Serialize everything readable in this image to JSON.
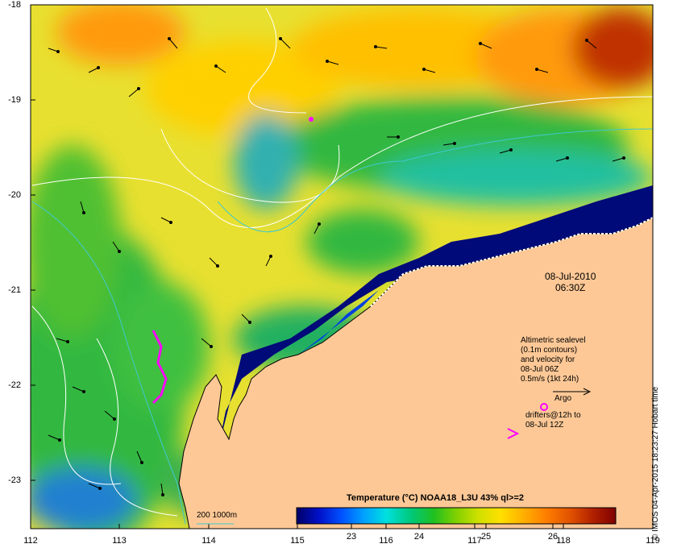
{
  "map": {
    "x_ticks": [
      "112",
      "113",
      "114",
      "115",
      "116",
      "117",
      "118",
      "119"
    ],
    "y_ticks": [
      "-18",
      "-19",
      "-20",
      "-21",
      "-22",
      "-23"
    ],
    "date": "08-Jul-2010",
    "time": "06:30Z",
    "land_color": "#fdc896",
    "deep_cold_color": "#000a78",
    "contour_color": "#ffffff",
    "bathy_color": "#40c8d0"
  },
  "legend": {
    "altimetry_line1": "Altimetric sealevel",
    "altimetry_line2": "(0.1m contours)",
    "altimetry_line3": "and velocity for",
    "altimetry_line4": "08-Jul 06Z",
    "altimetry_line5": "0.5m/s (1kt 24h)",
    "argo_label": "Argo",
    "drifters_line1": "drifters@12h to",
    "drifters_line2": "08-Jul 12Z",
    "argo_color": "#ff00ff",
    "drifter_color": "#ff00ff"
  },
  "colorbar": {
    "title": "Temperature (°C) NOAA18_L3U 43% ql>=2",
    "ticks": [
      "23",
      "24",
      "25",
      "26"
    ],
    "colors": [
      "#000066",
      "#0010c8",
      "#0050ff",
      "#00a0ff",
      "#00e0e0",
      "#00c878",
      "#20c020",
      "#80d000",
      "#d0e000",
      "#ffe000",
      "#ffb000",
      "#ff8000",
      "#e05000",
      "#b02000",
      "#800000"
    ]
  },
  "scale": {
    "label": "200 1000m"
  },
  "credit": "© IMOS 04-Apr-2015 18:23:27 Hobart time"
}
